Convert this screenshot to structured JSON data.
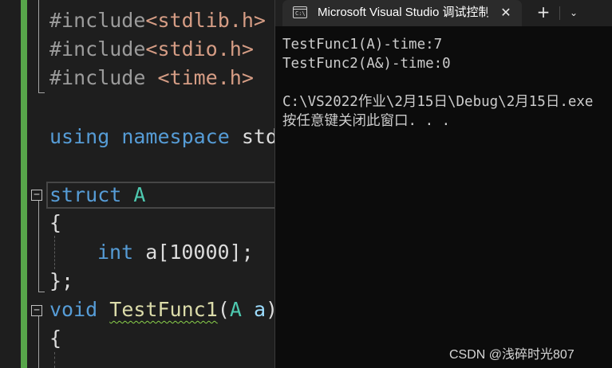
{
  "editor": {
    "lines": {
      "include1": {
        "directive": "#include",
        "header": "<stdlib.h>"
      },
      "include2": {
        "directive": "#include",
        "header": "<stdio.h>"
      },
      "include3": {
        "directive": "#include ",
        "header": "<time.h>"
      },
      "using": {
        "kw1": "using",
        "kw2": "namespace",
        "name": "std"
      },
      "struct": {
        "kw": "struct",
        "name": "A"
      },
      "brace_open": "{",
      "member": {
        "type": "int",
        "decl": "a[10000];"
      },
      "brace_close": "};",
      "func": {
        "ret": "void",
        "name": "TestFunc1",
        "open": "(",
        "ptype": "A",
        "pname": "a",
        "close": ")"
      },
      "func_brace": "{"
    },
    "fold_symbol": "−"
  },
  "terminal": {
    "tab_title": "Microsoft Visual Studio 调试控制台",
    "icon_label": "C:\\",
    "close_symbol": "✕",
    "new_tab_symbol": "+",
    "dropdown_symbol": "⌄",
    "output": [
      "TestFunc1(A)-time:7",
      "TestFunc2(A&)-time:0",
      "",
      "C:\\VS2022作业\\2月15日\\Debug\\2月15日.exe",
      "按任意键关闭此窗口. . ."
    ]
  },
  "watermark": "CSDN @浅碎时光807",
  "colors": {
    "editor_bg": "#1e1e1e",
    "terminal_bg": "#0c0c0c",
    "keyword": "#569cd6",
    "type": "#4ec9b0",
    "function": "#dcdcaa",
    "string": "#d69d85",
    "change_bar": "#57a64a"
  }
}
